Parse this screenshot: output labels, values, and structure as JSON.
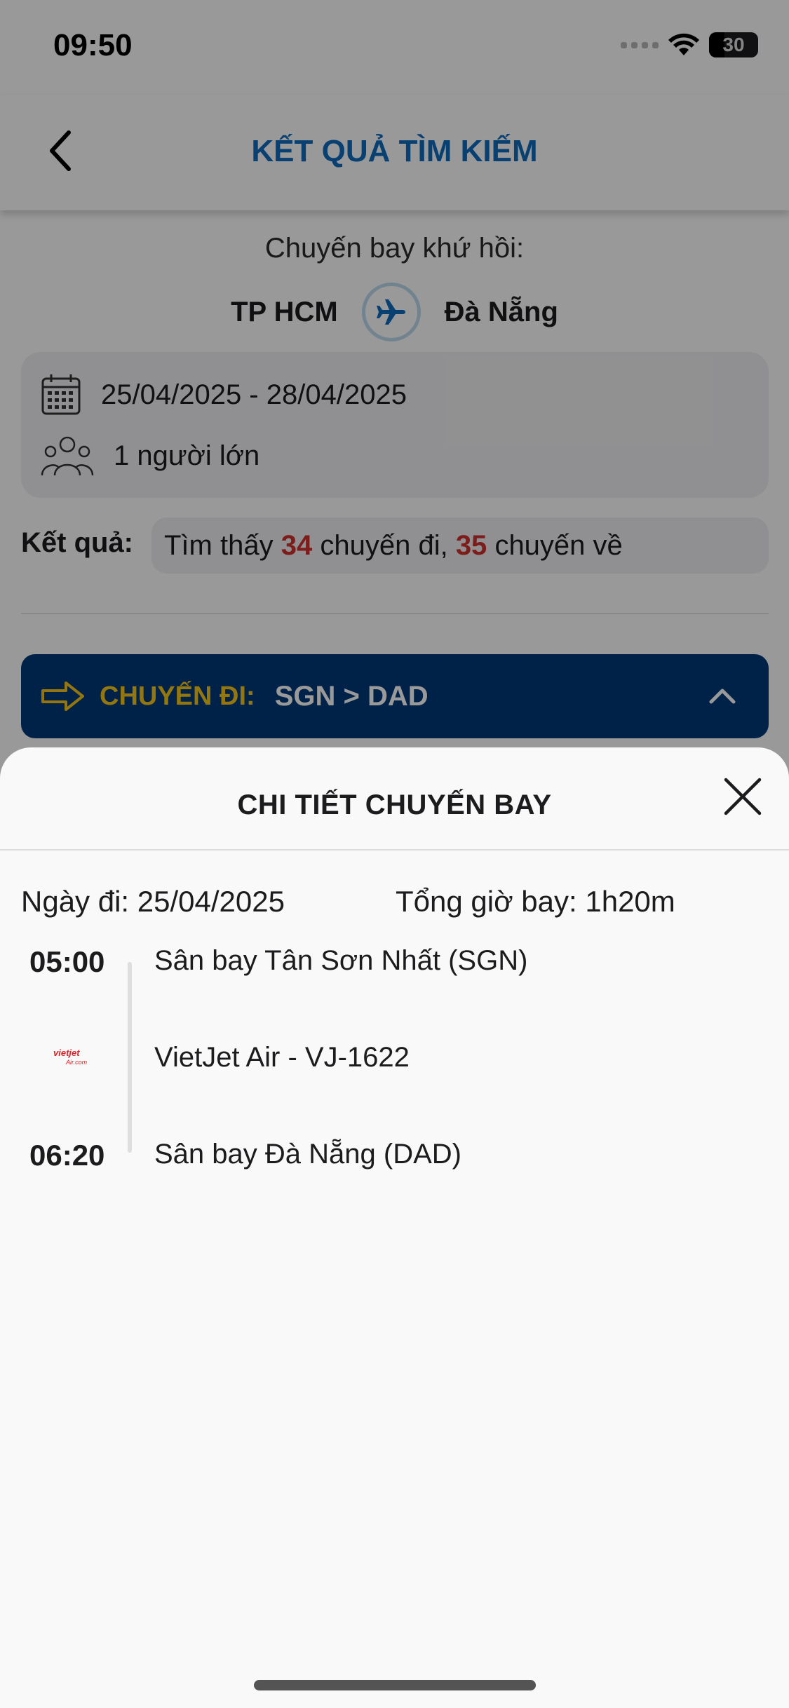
{
  "status": {
    "time": "09:50",
    "battery": "30"
  },
  "header": {
    "title": "KẾT QUẢ TÌM KIẾM"
  },
  "search": {
    "trip_type": "Chuyến bay khứ hồi:",
    "origin": "TP HCM",
    "destination": "Đà Nẵng",
    "dates": "25/04/2025 - 28/04/2025",
    "passengers": "1 người lớn"
  },
  "results": {
    "label": "Kết quả:",
    "prefix": "Tìm thấy",
    "outbound_count": "34",
    "outbound_text": "chuyến đi,",
    "return_count": "35",
    "return_text": "chuyến về"
  },
  "leg": {
    "label": "CHUYẾN ĐI:",
    "route": "SGN > DAD"
  },
  "sheet": {
    "title": "CHI TIẾT CHUYẾN BAY",
    "date": "Ngày đi: 25/04/2025",
    "duration": "Tổng giờ bay: 1h20m",
    "departure_time": "05:00",
    "departure_airport": "Sân bay Tân Sơn Nhất (SGN)",
    "airline": "VietJet Air - VJ-1622",
    "airline_logo_text": "vietjet Air.com",
    "arrival_time": "06:20",
    "arrival_airport": "Sân bay Đà Nẵng (DAD)"
  },
  "colors": {
    "brand_blue": "#0e6bbf",
    "leg_bar": "#003a7a",
    "leg_label": "#f5c518",
    "highlight_red": "#d0312d"
  },
  "icons": [
    "back-chevron-icon",
    "plane-icon",
    "calendar-icon",
    "people-icon",
    "arrow-right-icon",
    "chevron-up-icon",
    "close-icon",
    "vietjet-logo",
    "wifi-icon",
    "signal-icon",
    "battery-icon"
  ]
}
